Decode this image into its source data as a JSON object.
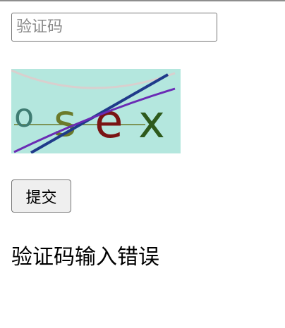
{
  "form": {
    "captcha_input": {
      "value": "",
      "placeholder": "验证码"
    },
    "captcha_image": {
      "characters": [
        "o",
        "s",
        "e",
        "x"
      ],
      "background_color": "#b4e7de",
      "character_colors": [
        "#3f7c72",
        "#6b7a2a",
        "#7a1414",
        "#2e5a1c"
      ],
      "line_colors": [
        "#1f3a8a",
        "#6a2bb5",
        "#e2c9c9"
      ]
    },
    "submit_label": "提交"
  },
  "status": {
    "message": "验证码输入错误"
  }
}
